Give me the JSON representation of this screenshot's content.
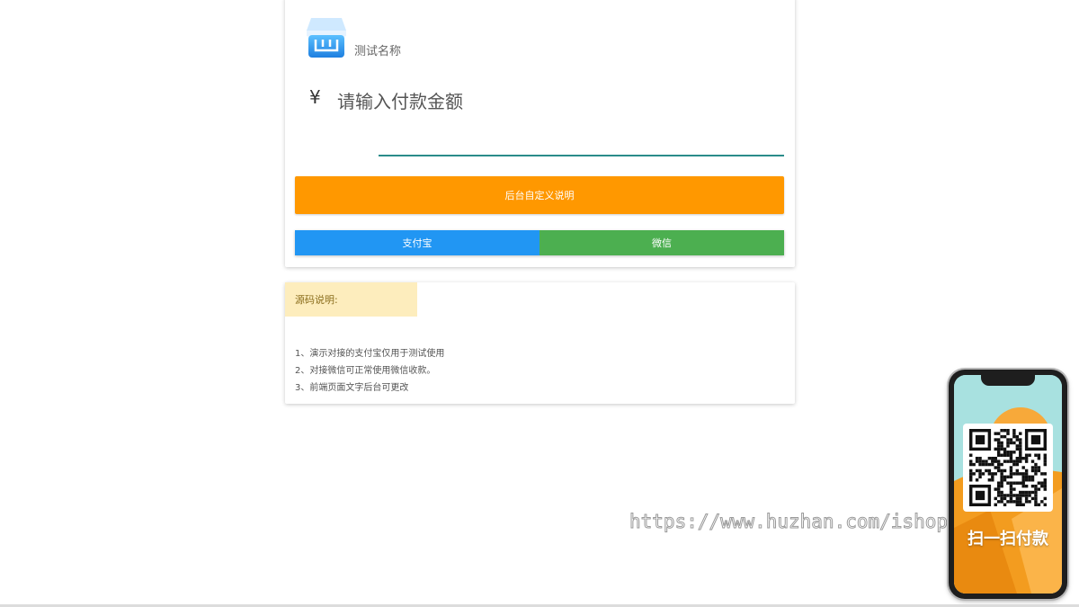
{
  "shop": {
    "name": "测试名称"
  },
  "payment": {
    "currency_symbol": "¥",
    "amount_placeholder": "请输入付款金额",
    "amount_value": "",
    "custom_description_label": "后台自定义说明",
    "alipay_label": "支付宝",
    "wechat_label": "微信"
  },
  "notes": {
    "title": "源码说明:",
    "items": [
      "1、演示对接的支付宝仅用于测试使用",
      "2、对接微信可正常使用微信收款。",
      "3、前端页面文字后台可更改"
    ]
  },
  "watermark": {
    "text": "https://www.huzhan.com/ishop39601"
  },
  "phone_promo": {
    "scan_label": "扫一扫付款"
  },
  "colors": {
    "orange": "#ff9800",
    "alipay_blue": "#2196f3",
    "wechat_green": "#4caf50",
    "input_underline": "#2a8c8a",
    "notes_tag_bg": "#fdedbd"
  }
}
